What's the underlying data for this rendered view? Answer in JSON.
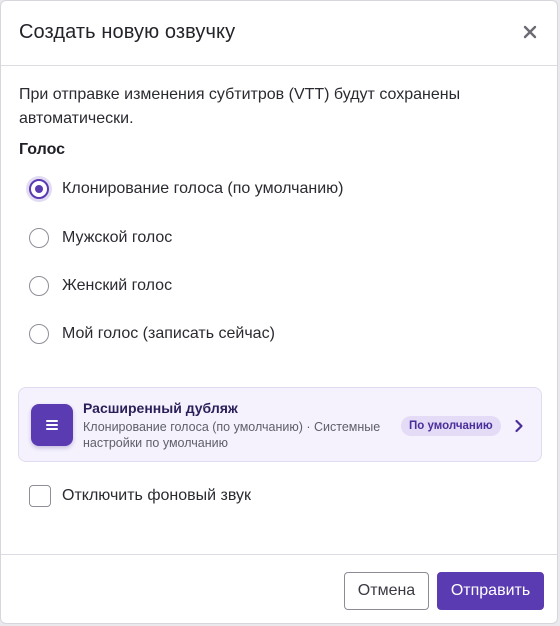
{
  "dialog": {
    "title": "Создать новую озвучку",
    "close_icon": "close-icon"
  },
  "info_text": "При отправке изменения субтитров (VTT) будут сохранены автоматически.",
  "voice": {
    "label": "Голос",
    "options": [
      {
        "label": "Клонирование голоса (по умолчанию)",
        "selected": true
      },
      {
        "label": "Мужской голос",
        "selected": false
      },
      {
        "label": "Женский голос",
        "selected": false
      },
      {
        "label": "Мой голос (записать сейчас)",
        "selected": false
      }
    ]
  },
  "advanced_dub": {
    "icon": "list-icon",
    "title": "Расширенный дубляж",
    "description": "Клонирование голоса (по умолчанию) · Системные настройки по умолчанию",
    "badge": "По умолчанию",
    "chevron_icon": "chevron-right-icon"
  },
  "background_sound": {
    "label": "Отключить фоновый звук",
    "checked": false
  },
  "footer": {
    "cancel_label": "Отмена",
    "submit_label": "Отправить"
  },
  "colors": {
    "accent": "#5b3bb1",
    "card_background": "#f5f2fd",
    "badge_background": "#e4dbf7"
  }
}
